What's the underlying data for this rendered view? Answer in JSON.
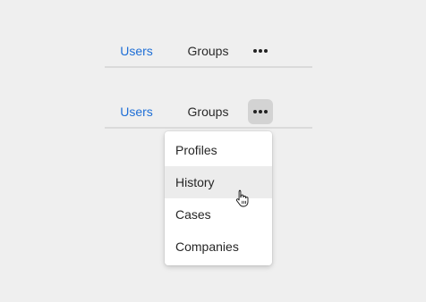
{
  "tabs_top": {
    "items": [
      {
        "label": "Users",
        "active": true
      },
      {
        "label": "Groups",
        "active": false
      }
    ],
    "more_icon": "more-horizontal-icon"
  },
  "tabs_bottom": {
    "items": [
      {
        "label": "Users",
        "active": true
      },
      {
        "label": "Groups",
        "active": false
      }
    ],
    "more_icon": "more-horizontal-icon",
    "more_pressed": true
  },
  "overflow_menu": {
    "items": [
      {
        "label": "Profiles"
      },
      {
        "label": "History",
        "hovered": true
      },
      {
        "label": "Cases"
      },
      {
        "label": "Companies"
      }
    ]
  },
  "pointer": "hand-pointer-icon",
  "colors": {
    "accent": "#1f6fd6",
    "background": "#efefef",
    "hover": "#ececec",
    "pressed": "#d3d3d3"
  }
}
